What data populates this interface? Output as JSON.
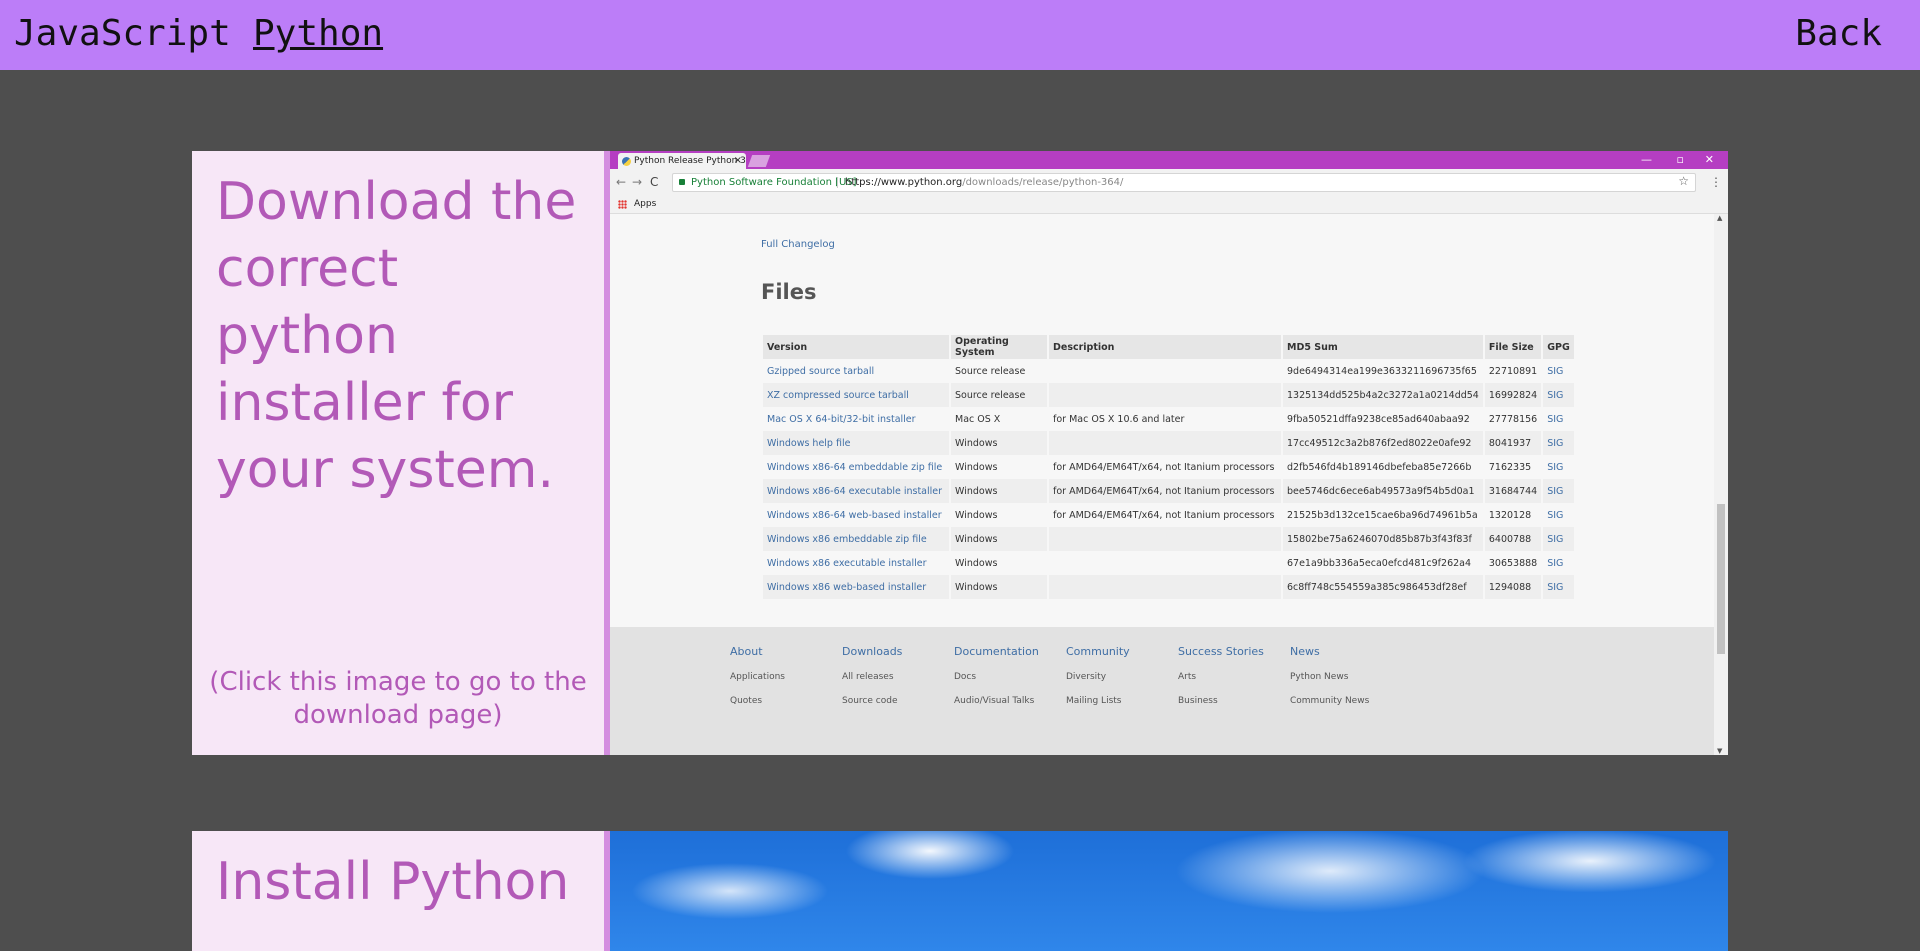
{
  "nav": {
    "javascript": "JavaScript",
    "python": "Python",
    "back": "Back"
  },
  "steps": [
    {
      "text": "Download the correct python installer for your system.",
      "hint": "(Click this image to go to the download page)"
    },
    {
      "text": "Install Python"
    }
  ],
  "browser": {
    "tab_title": "Python Release Python 3",
    "tab_close": "×",
    "window_controls": {
      "minimize": "—",
      "maximize": "▫",
      "close": "✕"
    },
    "nav_icons": {
      "back": "←",
      "forward": "→",
      "reload": "C"
    },
    "secure_label": "Python Software Foundation [US]",
    "url_host": "https://www.python.org",
    "url_path": "/downloads/release/python-364/",
    "bookmark_star": "☆",
    "menu": "⋮",
    "bookmarks_apps": "Apps"
  },
  "page": {
    "changelog": "Full Changelog",
    "files_heading": "Files",
    "columns": [
      "Version",
      "Operating System",
      "Description",
      "MD5 Sum",
      "File Size",
      "GPG"
    ],
    "rows": [
      [
        "Gzipped source tarball",
        "Source release",
        "",
        "9de6494314ea199e3633211696735f65",
        "22710891",
        "SIG"
      ],
      [
        "XZ compressed source tarball",
        "Source release",
        "",
        "1325134dd525b4a2c3272a1a0214dd54",
        "16992824",
        "SIG"
      ],
      [
        "Mac OS X 64-bit/32-bit installer",
        "Mac OS X",
        "for Mac OS X 10.6 and later",
        "9fba50521dffa9238ce85ad640abaa92",
        "27778156",
        "SIG"
      ],
      [
        "Windows help file",
        "Windows",
        "",
        "17cc49512c3a2b876f2ed8022e0afe92",
        "8041937",
        "SIG"
      ],
      [
        "Windows x86-64 embeddable zip file",
        "Windows",
        "for AMD64/EM64T/x64, not Itanium processors",
        "d2fb546fd4b189146dbefeba85e7266b",
        "7162335",
        "SIG"
      ],
      [
        "Windows x86-64 executable installer",
        "Windows",
        "for AMD64/EM64T/x64, not Itanium processors",
        "bee5746dc6ece6ab49573a9f54b5d0a1",
        "31684744",
        "SIG"
      ],
      [
        "Windows x86-64 web-based installer",
        "Windows",
        "for AMD64/EM64T/x64, not Itanium processors",
        "21525b3d132ce15cae6ba96d74961b5a",
        "1320128",
        "SIG"
      ],
      [
        "Windows x86 embeddable zip file",
        "Windows",
        "",
        "15802be75a6246070d85b87b3f43f83f",
        "6400788",
        "SIG"
      ],
      [
        "Windows x86 executable installer",
        "Windows",
        "",
        "67e1a9bb336a5eca0efcd481c9f262a4",
        "30653888",
        "SIG"
      ],
      [
        "Windows x86 web-based installer",
        "Windows",
        "",
        "6c8ff748c554559a385c986453df28ef",
        "1294088",
        "SIG"
      ]
    ],
    "footer": [
      {
        "heading": "About",
        "items": [
          "Applications",
          "Quotes"
        ]
      },
      {
        "heading": "Downloads",
        "items": [
          "All releases",
          "Source code"
        ]
      },
      {
        "heading": "Documentation",
        "items": [
          "Docs",
          "Audio/Visual Talks"
        ]
      },
      {
        "heading": "Community",
        "items": [
          "Diversity",
          "Mailing Lists"
        ]
      },
      {
        "heading": "Success Stories",
        "items": [
          "Arts",
          "Business"
        ]
      },
      {
        "heading": "News",
        "items": [
          "Python News",
          "Community News"
        ]
      }
    ]
  },
  "colors": {
    "nav_bg": "#bc7df8",
    "card_bg": "#f7e7f7",
    "card_text": "#b259b7",
    "page_bg": "#4e4e4e",
    "browser_frame": "#b53ec2"
  }
}
